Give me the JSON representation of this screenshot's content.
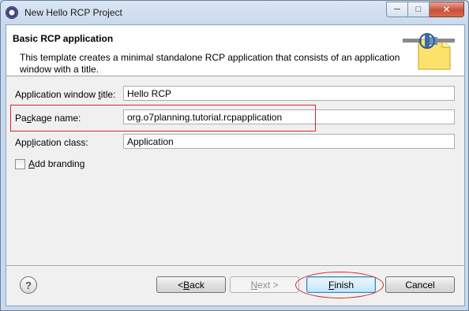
{
  "window": {
    "title": "New Hello RCP Project",
    "minimize": "─",
    "maximize": "□",
    "close": "✕"
  },
  "header": {
    "title": "Basic RCP application",
    "description": "This template creates a minimal standalone RCP application that consists of an application window with a title.",
    "image_icon": "plugin-wizard-icon"
  },
  "form": {
    "window_title_label_a": "Application window ",
    "window_title_label_u": "t",
    "window_title_label_b": "itle:",
    "window_title_value": "Hello RCP",
    "package_label_a": "Pa",
    "package_label_u": "c",
    "package_label_b": "kage name:",
    "package_value": "org.o7planning.tutorial.rcpapplication",
    "class_label_a": "App",
    "class_label_u": "l",
    "class_label_b": "ication class:",
    "class_value": "Application",
    "branding_label_a": "",
    "branding_label_u": "A",
    "branding_label_b": "dd branding",
    "branding_checked": false
  },
  "footer": {
    "help_icon": "help-icon",
    "help_glyph": "?",
    "back_prefix": "< ",
    "back_u": "B",
    "back_rest": "ack",
    "next_u": "N",
    "next_rest": "ext >",
    "finish_u": "F",
    "finish_rest": "inish",
    "cancel_label": "Cancel"
  },
  "colors": {
    "highlight": "#cc2b2b",
    "close_button": "#c9503a"
  }
}
